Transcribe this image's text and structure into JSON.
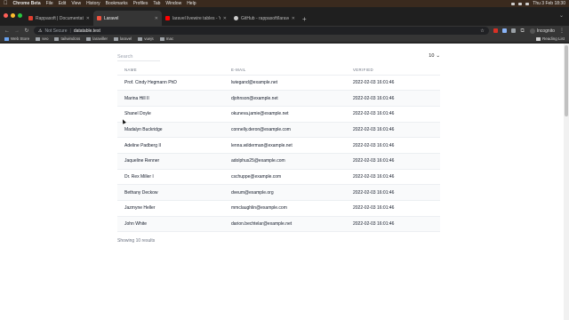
{
  "menubar": {
    "app": "Chrome Beta",
    "items": [
      "File",
      "Edit",
      "View",
      "History",
      "Bookmarks",
      "Profiles",
      "Tab",
      "Window",
      "Help"
    ],
    "clock": "Thu 3 Feb 18:30"
  },
  "tabs": [
    {
      "title": "Rappasoft | Documentation | L",
      "favicon_color": "#e03e2f",
      "active": false
    },
    {
      "title": "Laravel",
      "favicon_color": "#f05340",
      "active": true
    },
    {
      "title": "laravel livewire tables - YouTu",
      "favicon_color": "#ff0000",
      "active": false
    },
    {
      "title": "GitHub - rappasoft/laravel-liv",
      "favicon_color": "#cccccc",
      "active": false
    }
  ],
  "toolbar": {
    "security": "Not Secure",
    "url": "datatable.test",
    "profile": "Incognito"
  },
  "bookmarks": {
    "items": [
      "Web Store",
      "seo",
      "tailwindcss",
      "laraviller",
      "laravel",
      "vuejs",
      "mac"
    ],
    "reading_list": "Reading List"
  },
  "page": {
    "search_placeholder": "Search",
    "per_page": "10",
    "columns": [
      "NAME",
      "E-MAIL",
      "VERIFIED"
    ],
    "rows": [
      [
        "Prof. Cindy Hegmann PhD",
        "lwiegand@example.net",
        "2022-02-03 16:01:46"
      ],
      [
        "Marina Hill II",
        "djohnson@example.net",
        "2022-02-03 16:01:46"
      ],
      [
        "Shanel Doyle",
        "okuneva.jamie@example.net",
        "2022-02-03 16:01:46"
      ],
      [
        "Madalyn Buckridge",
        "connelly.deron@example.com",
        "2022-02-03 16:01:46"
      ],
      [
        "Adeline Padberg II",
        "lenna.wilderman@example.net",
        "2022-02-03 16:01:46"
      ],
      [
        "Jaqueline Renner",
        "adolphus25@example.com",
        "2022-02-03 16:01:46"
      ],
      [
        "Dr. Rex Miller I",
        "cschuppe@example.com",
        "2022-02-03 16:01:46"
      ],
      [
        "Bethany Deckow",
        "dveum@example.org",
        "2022-02-03 16:01:46"
      ],
      [
        "Jazmyne Heller",
        "mmclaughlin@example.com",
        "2022-02-03 16:01:46"
      ],
      [
        "John White",
        "darion.bechtelar@example.net",
        "2022-02-03 16:01:46"
      ]
    ],
    "footer": "Showing 10 results"
  },
  "colors": {
    "menubar_bg": "#3a2a1e",
    "tabstrip_bg": "#1f1f1f",
    "toolbar_bg": "#353535",
    "page_bg": "#ffffff",
    "row_stripe": "#f9fafb"
  }
}
